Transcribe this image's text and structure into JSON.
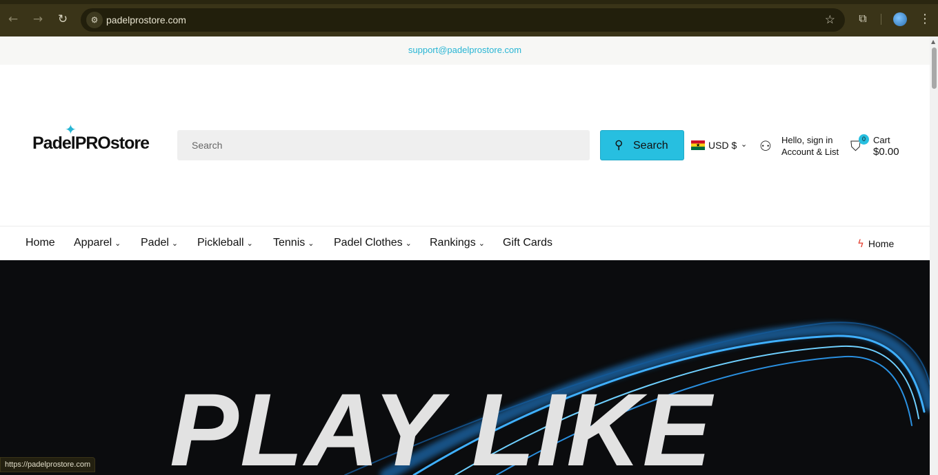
{
  "browser": {
    "url": "padelprostore.com",
    "status_url": "https://padelprostore.com"
  },
  "topbar": {
    "email": "support@padelprostore.com"
  },
  "header": {
    "logo": "PadelPROstore",
    "search_placeholder": "Search",
    "search_button": "Search",
    "currency": "USD $",
    "account_line1": "Hello, sign in",
    "account_line2": "Account & List",
    "cart_label": "Cart",
    "cart_total": "$0.00",
    "cart_count": "0"
  },
  "nav": {
    "items": [
      "Home",
      "Apparel",
      "Padel",
      "Pickleball",
      "Tennis",
      "Padel Clothes",
      "Rankings",
      "Gift Cards"
    ],
    "right_link": "Home"
  },
  "hero": {
    "headline": "PLAY LIKE"
  },
  "colors": {
    "accent": "#27bfe0",
    "bolt": "#e43b2c"
  }
}
